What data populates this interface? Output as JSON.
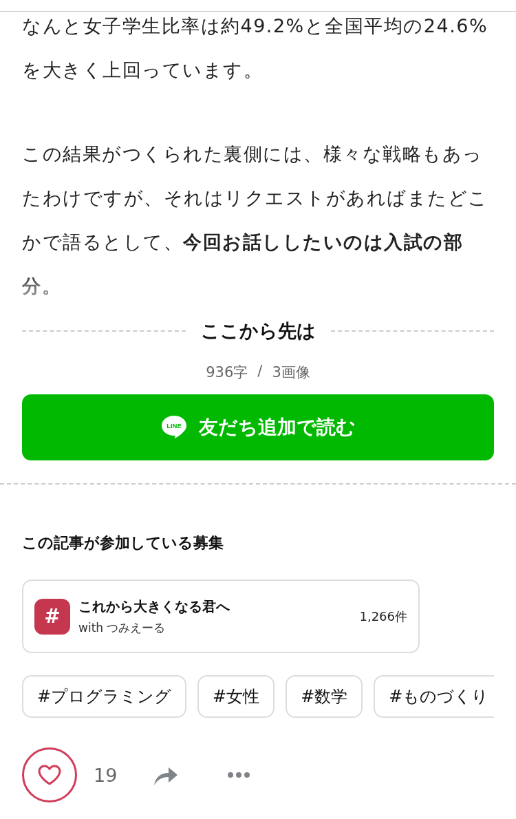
{
  "paragraphs": [
    {
      "text": "なんと女子学生比率は約49.2%と全国平均の24.6%を大きく上回っています。",
      "faded": false
    },
    {
      "text": "この結果がつくられた裏側には、様々な戦略もあったわけですが、それはリクエストがあればまたどこかで語るとして、**今回お話ししたいのは入試の部分。**",
      "faded": true
    }
  ],
  "paywall": {
    "title": "ここから先は",
    "chars": "936字",
    "separator": "/",
    "images": "3画像",
    "button": {
      "icon_label": "LINE",
      "label": "友だち追加で読む"
    }
  },
  "contest": {
    "heading": "この記事が参加している募集",
    "card": {
      "icon": "#",
      "title": "これから大きくなる君へ",
      "subtitle": "with つみえーる",
      "count": "1,266件"
    }
  },
  "tags": [
    "#プログラミング",
    "#女性",
    "#数学",
    "#ものづくり"
  ],
  "actions": {
    "likes": "19"
  }
}
